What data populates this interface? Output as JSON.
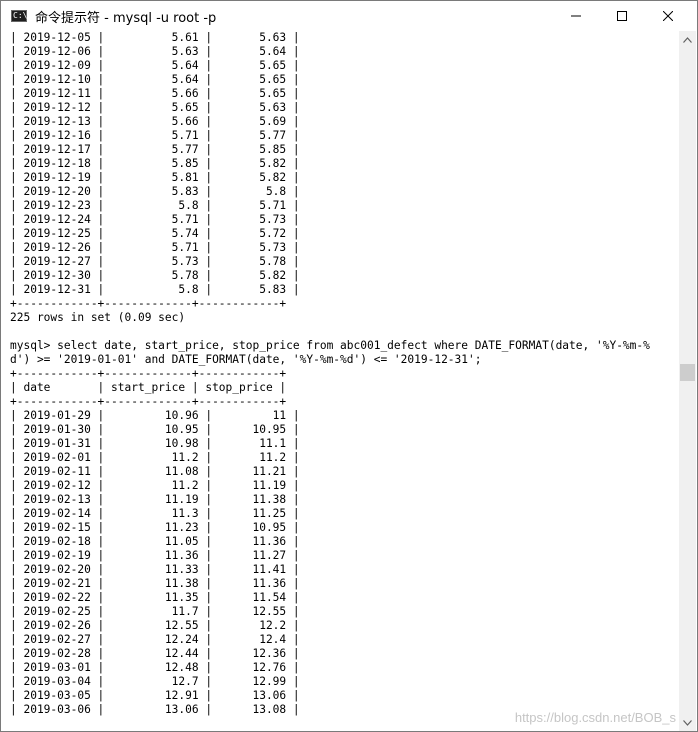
{
  "window": {
    "title": "命令提示符 - mysql  -u root -p",
    "app_icon_text": "C:\\",
    "minimize_glyph": "─",
    "maximize_glyph": "☐",
    "close_glyph": "✕"
  },
  "console": {
    "lines": [
      "| 2019-12-05 |          5.61 |       5.63 |",
      "| 2019-12-06 |          5.63 |       5.64 |",
      "| 2019-12-09 |          5.64 |       5.65 |",
      "| 2019-12-10 |          5.64 |       5.65 |",
      "| 2019-12-11 |          5.66 |       5.65 |",
      "| 2019-12-12 |          5.65 |       5.63 |",
      "| 2019-12-13 |          5.66 |       5.69 |",
      "| 2019-12-16 |          5.71 |       5.77 |",
      "| 2019-12-17 |          5.77 |       5.85 |",
      "| 2019-12-18 |          5.85 |       5.82 |",
      "| 2019-12-19 |          5.81 |       5.82 |",
      "| 2019-12-20 |          5.83 |        5.8 |",
      "| 2019-12-23 |           5.8 |       5.71 |",
      "| 2019-12-24 |          5.71 |       5.73 |",
      "| 2019-12-25 |          5.74 |       5.72 |",
      "| 2019-12-26 |          5.71 |       5.73 |",
      "| 2019-12-27 |          5.73 |       5.78 |",
      "| 2019-12-30 |          5.78 |       5.82 |",
      "| 2019-12-31 |           5.8 |       5.83 |",
      "+------------+-------------+------------+",
      "225 rows in set (0.09 sec)",
      "",
      "mysql> select date, start_price, stop_price from abc001_defect where DATE_FORMAT(date, '%Y-%m-%",
      "d') >= '2019-01-01' and DATE_FORMAT(date, '%Y-%m-%d') <= '2019-12-31';",
      "+------------+-------------+------------+",
      "| date       | start_price | stop_price |",
      "+------------+-------------+------------+",
      "| 2019-01-29 |         10.96 |         11 |",
      "| 2019-01-30 |         10.95 |      10.95 |",
      "| 2019-01-31 |         10.98 |       11.1 |",
      "| 2019-02-01 |          11.2 |       11.2 |",
      "| 2019-02-11 |         11.08 |      11.21 |",
      "| 2019-02-12 |          11.2 |      11.19 |",
      "| 2019-02-13 |         11.19 |      11.38 |",
      "| 2019-02-14 |          11.3 |      11.25 |",
      "| 2019-02-15 |         11.23 |      10.95 |",
      "| 2019-02-18 |         11.05 |      11.36 |",
      "| 2019-02-19 |         11.36 |      11.27 |",
      "| 2019-02-20 |         11.33 |      11.41 |",
      "| 2019-02-21 |         11.38 |      11.36 |",
      "| 2019-02-22 |         11.35 |      11.54 |",
      "| 2019-02-25 |          11.7 |      12.55 |",
      "| 2019-02-26 |         12.55 |       12.2 |",
      "| 2019-02-27 |         12.24 |       12.4 |",
      "| 2019-02-28 |         12.44 |      12.36 |",
      "| 2019-03-01 |         12.48 |      12.76 |",
      "| 2019-03-04 |          12.7 |      12.99 |",
      "| 2019-03-05 |         12.91 |      13.06 |",
      "| 2019-03-06 |         13.06 |      13.08 |"
    ]
  },
  "watermark": "https://blog.csdn.net/BOB_s",
  "colors": {
    "console_bg": "#ffffff",
    "console_text": "#000000",
    "scrollbar_track": "#f0f0f0",
    "scrollbar_thumb": "#cdcdcd"
  }
}
